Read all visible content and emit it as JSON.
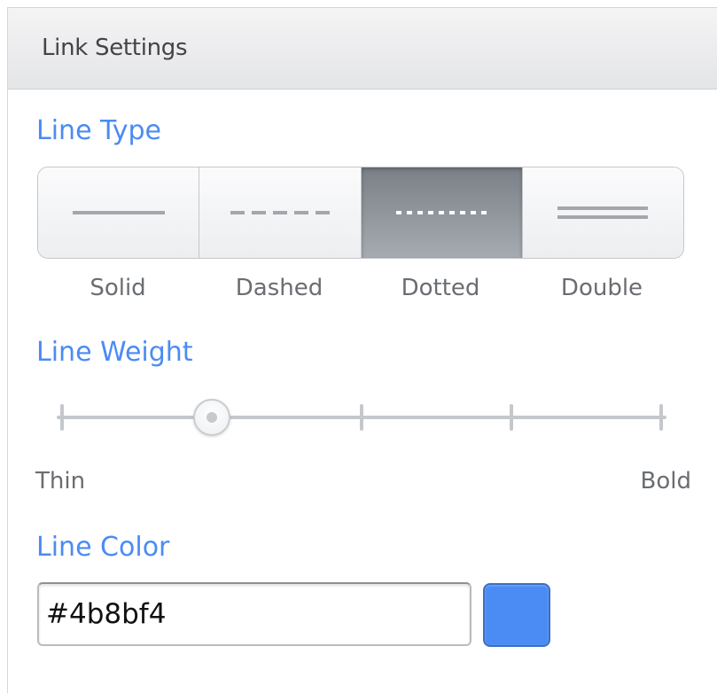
{
  "panel": {
    "title": "Link Settings"
  },
  "line_type": {
    "label": "Line Type",
    "selected": "Dotted",
    "options": [
      {
        "label": "Solid",
        "icon": "line-solid-icon"
      },
      {
        "label": "Dashed",
        "icon": "line-dashed-icon"
      },
      {
        "label": "Dotted",
        "icon": "line-dotted-icon"
      },
      {
        "label": "Double",
        "icon": "line-double-icon"
      }
    ]
  },
  "line_weight": {
    "label": "Line Weight",
    "min_label": "Thin",
    "max_label": "Bold",
    "steps": 5,
    "selected_step": 1
  },
  "line_color": {
    "label": "Line Color",
    "value": "#4b8bf4",
    "swatch_color": "#4b8bf4"
  },
  "colors": {
    "accent": "#4b8bf4",
    "active_segment": "#8c9197"
  }
}
